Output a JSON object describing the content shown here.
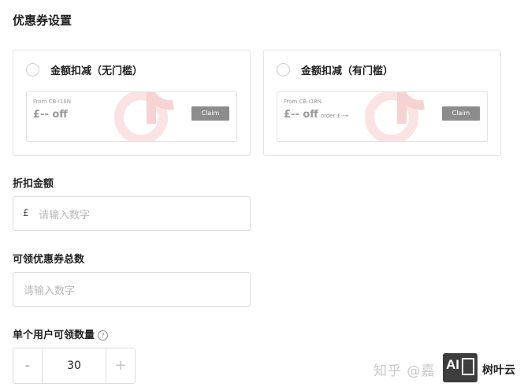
{
  "page_title": "优惠券设置",
  "options": [
    {
      "title": "金额扣减（无门槛）",
      "selected": false,
      "preview": {
        "from": "From CB-I18N",
        "amount": "£-- off",
        "order": "",
        "button": "Claim"
      }
    },
    {
      "title": "金额扣减（有门槛）",
      "selected": false,
      "preview": {
        "from": "From CB-I18N",
        "amount": "£-- off",
        "order": "order £--+",
        "button": "Claim"
      }
    }
  ],
  "discount": {
    "label": "折扣金额",
    "currency": "£",
    "placeholder": "请输入数字"
  },
  "total": {
    "label": "可领优惠券总数",
    "placeholder": "请输入数字"
  },
  "per_user": {
    "label": "单个用户可领数量",
    "help_icon": "?",
    "minus": "-",
    "plus": "+",
    "value": "30"
  },
  "watermark": {
    "zhihu": "知乎 @嘉",
    "logo_text": "AI",
    "brand": "树叶云"
  },
  "colors": {
    "claim_button": "#8c8c8c",
    "border": "#dcdcdc",
    "watermark": "#f2c4c4"
  }
}
